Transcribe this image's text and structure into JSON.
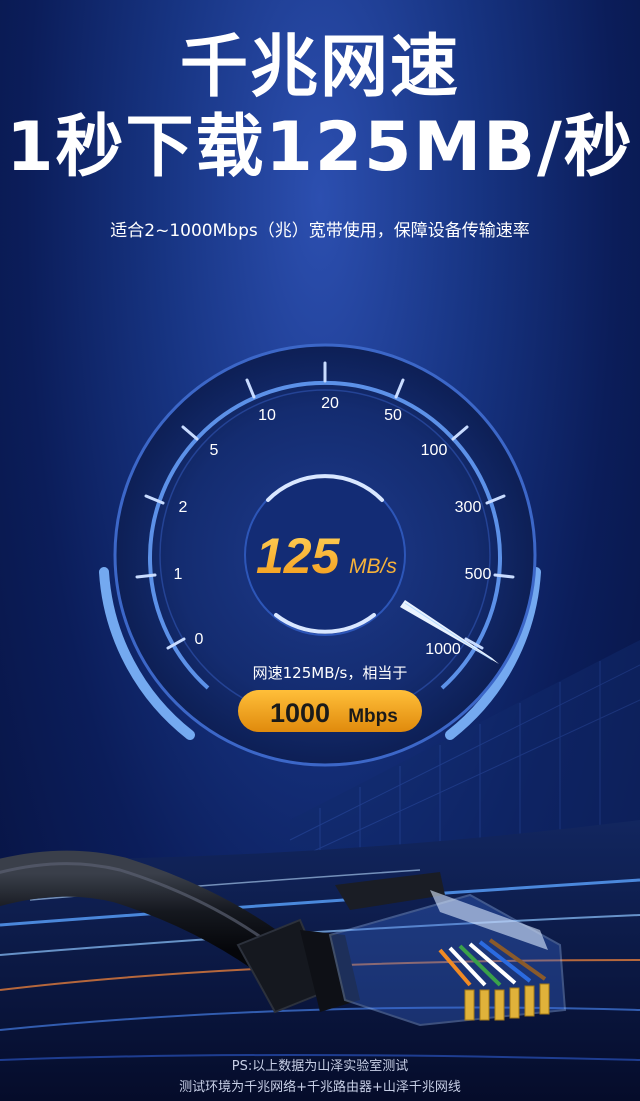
{
  "headline": {
    "line1": "千兆网速",
    "line2": "1秒下载125MB/秒"
  },
  "subtitle": "适合2~1000Mbps（兆）宽带使用，保障设备传输速率",
  "gauge": {
    "ticks": [
      "0",
      "1",
      "2",
      "5",
      "10",
      "20",
      "50",
      "100",
      "300",
      "500",
      "1000"
    ],
    "value": "125",
    "unit": "MB/s",
    "note": "网速125MB/s，相当于",
    "badge_value": "1000",
    "badge_unit": "Mbps"
  },
  "footer": {
    "line1": "PS:以上数据为山泽实验室测试",
    "line2": "测试环境为千兆网络+千兆路由器+山泽千兆网线"
  },
  "colors": {
    "accent_orange": "#f5a623",
    "badge_orange": "#f0a11a",
    "glow_blue": "#6fb3ff"
  }
}
